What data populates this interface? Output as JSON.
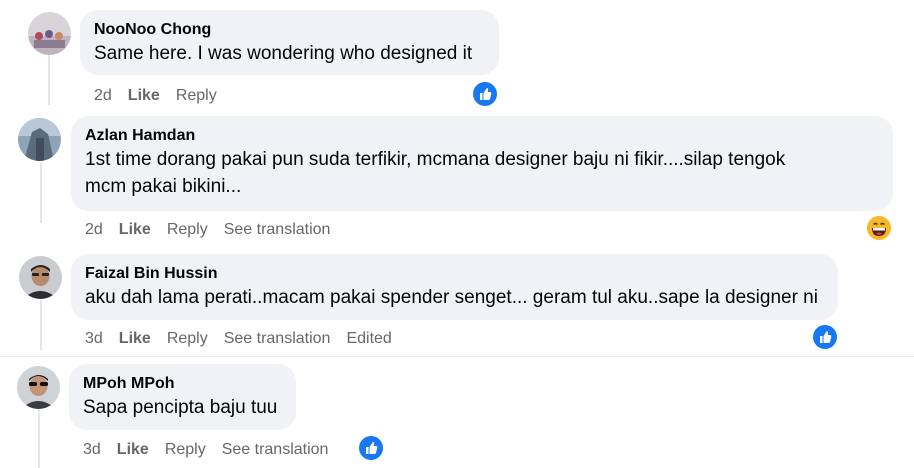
{
  "comments": [
    {
      "author": "NooNoo Chong",
      "text_lines": [
        "Same here. I was wondering who designed it"
      ],
      "time": "2d",
      "like": "Like",
      "reply": "Reply",
      "reaction": "like-icon"
    },
    {
      "author": "Azlan Hamdan",
      "text_lines": [
        "1st time dorang pakai pun suda terfikir, mcmana designer baju ni fikir....silap tengok",
        "mcm pakai bikini..."
      ],
      "time": "2d",
      "like": "Like",
      "reply": "Reply",
      "translation": "See translation",
      "reaction": "grinning-face-icon"
    },
    {
      "author": "Faizal Bin Hussin",
      "text_lines": [
        "aku dah lama perati..macam pakai spender senget... geram tul aku..sape la designer ni"
      ],
      "time": "3d",
      "like": "Like",
      "reply": "Reply",
      "translation": "See translation",
      "edited": "Edited",
      "reaction": "like-icon"
    },
    {
      "author": "MPoh MPoh",
      "text_lines": [
        "Sapa pencipta baju tuu"
      ],
      "time": "3d",
      "like": "Like",
      "reply": "Reply",
      "translation": "See translation",
      "reaction": "like-icon"
    }
  ],
  "colors": {
    "bubble": "#f0f2f5",
    "meta_text": "#65676b",
    "like_blue": "#1877f2",
    "emoji_yellow": "#f7b928",
    "thread_line": "#e4e6eb"
  }
}
